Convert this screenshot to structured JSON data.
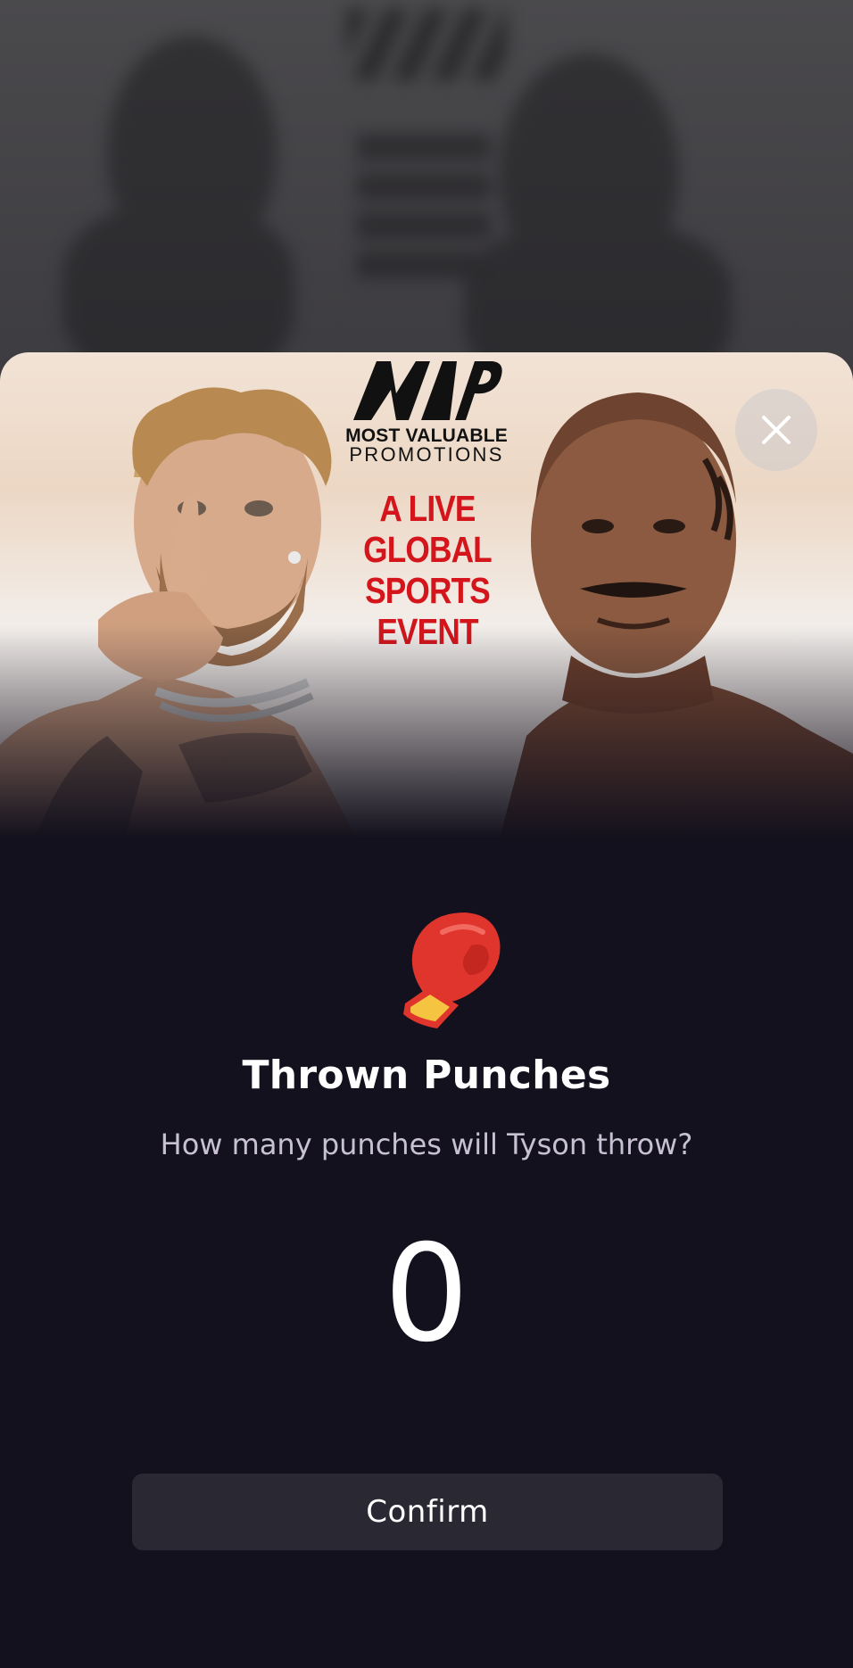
{
  "promo": {
    "logo_mark": "MVP",
    "brand_name": "MOST VALUABLE",
    "brand_sub": "PROMOTIONS",
    "tagline": [
      "A LIVE",
      "GLOBAL",
      "SPORTS",
      "EVENT"
    ]
  },
  "prediction": {
    "icon": "boxing-glove-icon",
    "title": "Thrown Punches",
    "question": "How many punches will Tyson throw?",
    "value": "0"
  },
  "actions": {
    "confirm_label": "Confirm",
    "close_icon": "close-icon"
  },
  "colors": {
    "sheet_background": "#13111d",
    "button_background": "#2a2833",
    "tagline_red": "#d4161c",
    "question_text": "#c7c1d3"
  }
}
